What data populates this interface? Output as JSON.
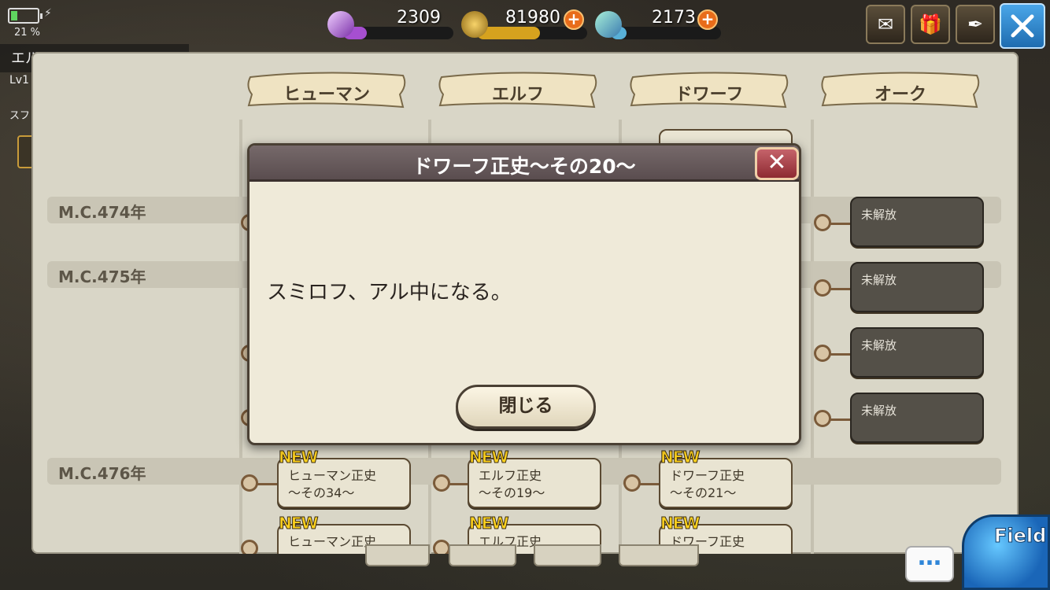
{
  "hud": {
    "battery_pct": "21 %",
    "player_name": "エル",
    "player_level": "Lv1",
    "player_sub": "スフ",
    "currencies": [
      {
        "name": "crystal-icon",
        "value": "2309",
        "color": "#a64fd0"
      },
      {
        "name": "gold-coin-icon",
        "value": "81980",
        "color": "#d6a21e"
      },
      {
        "name": "gem-icon",
        "value": "2173",
        "color": "#58b0d8"
      }
    ],
    "top_buttons": [
      "mail-icon",
      "gift-icon",
      "quill-icon"
    ]
  },
  "tabs": [
    "ヒューマン",
    "エルフ",
    "ドワーフ",
    "オーク"
  ],
  "years": [
    "M.C.474年",
    "M.C.475年",
    "M.C.476年"
  ],
  "locked_label": "未解放",
  "new_label": "NEW",
  "cards": {
    "human_34": {
      "line1": "ヒューマン正史",
      "line2": "〜その34〜"
    },
    "elf_19": {
      "line1": "エルフ正史",
      "line2": "〜その19〜"
    },
    "dwarf_21": {
      "line1": "ドワーフ正史",
      "line2": "〜その21〜"
    },
    "human_next": "ヒューマン正史",
    "elf_next": "エルフ正史",
    "dwarf_next": "ドワーフ正史"
  },
  "modal": {
    "title": "ドワーフ正史〜その20〜",
    "body": "スミロフ、アル中になる。",
    "close_button": "閉じる"
  },
  "bottom": {
    "chat": "…",
    "field": "Field"
  }
}
